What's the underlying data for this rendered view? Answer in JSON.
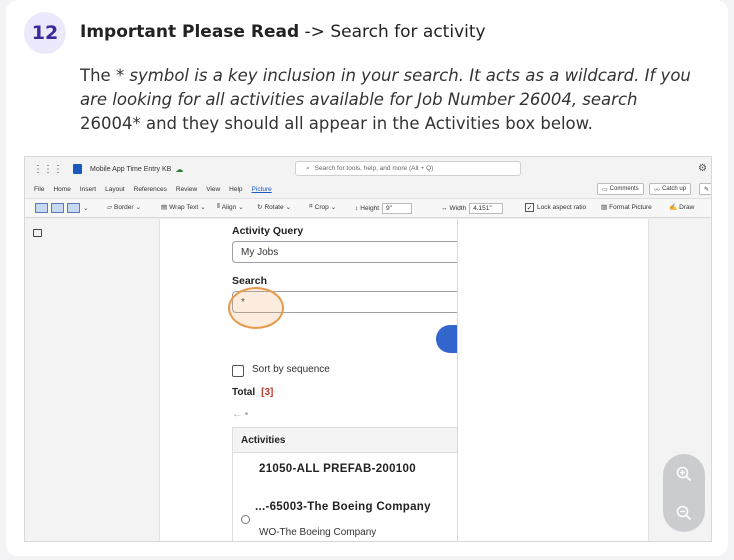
{
  "step": {
    "number": "12",
    "title_bold": "Important Please Read",
    "title_rest": " -> Search for activity",
    "body_1": "The ",
    "body_2_italic": "* symbol is a key inclusion in your search. It acts as a wildcard. If you are looking for all activities available for Job Number 26004, search",
    "body_3": " 26004* and they should all appear in the Activities box below."
  },
  "screenshot": {
    "titlebar": {
      "doc_title": "Mobile App Time Entry KB",
      "search_placeholder": "Search for tools, help, and more (Alt + Q)"
    },
    "menu": [
      "File",
      "Home",
      "Insert",
      "Layout",
      "References",
      "Review",
      "View",
      "Help",
      "Picture"
    ],
    "menu_active": "Picture",
    "right_buttons": {
      "comments": "Comments",
      "catch_up": "Catch up"
    },
    "toolbar": {
      "border": "Border",
      "wrap_text": "Wrap Text",
      "align": "Align",
      "rotate": "Rotate",
      "crop": "Crop",
      "height_label": "Height",
      "height_value": "9\"",
      "width_label": "Width",
      "width_value": "4.151\"",
      "lock_aspect": "Lock aspect ratio",
      "format_picture": "Format Picture",
      "draw": "Draw"
    },
    "app": {
      "activity_query_label": "Activity Query",
      "activity_query_value": "My Jobs",
      "search_label": "Search",
      "search_value": "*",
      "sort_label": "Sort by sequence",
      "total_label": "Total",
      "total_count": "[3]",
      "activities_header": "Activities",
      "activity_1": "21050-ALL PREFAB-200100",
      "activity_2": "...-65003-The Boeing Company",
      "activity_2_sub": "WO-The Boeing Company"
    }
  },
  "colors": {
    "badge_bg": "#ebe9fb",
    "badge_text": "#3a2a9a",
    "highlight": "#e89a4a",
    "total_count": "#c0392b",
    "blue_button": "#3366cc"
  }
}
